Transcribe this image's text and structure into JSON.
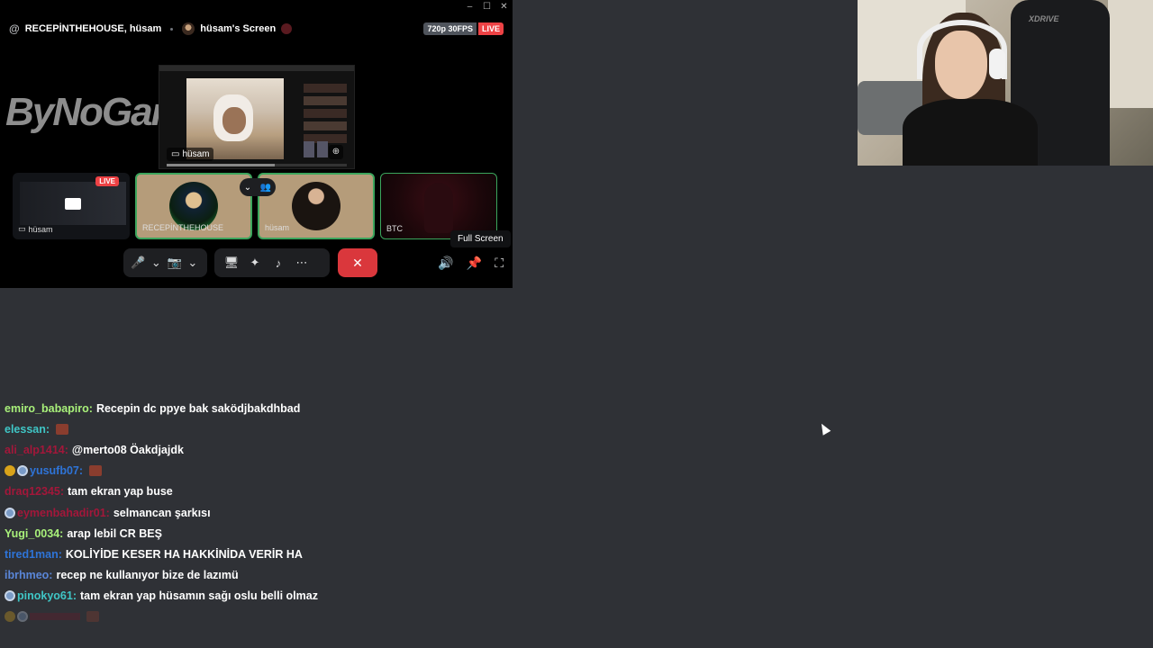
{
  "call": {
    "channel": "RECEPİNTHEHOUSE, hüsam",
    "screen_title": "hüsam's Screen",
    "quality": "720p 30FPS",
    "live_label": "LIVE",
    "brand": "ByNoGame",
    "stage_label": "hüsam",
    "tiles": [
      {
        "label": "hüsam",
        "live": "LIVE"
      },
      {
        "label": "RECEPİNTHEHOUSE"
      },
      {
        "label": "hüsam"
      },
      {
        "label": "BTC"
      }
    ],
    "tooltip": "Full Screen",
    "icons": {
      "mic": "🎤",
      "chevron": "⌄",
      "camera_off": "📷",
      "share": "🖥",
      "activity": "✦",
      "soundboard": "♪",
      "more": "⋯",
      "end": "✕",
      "volume": "🔊",
      "pin": "📌",
      "fullscreen": "⛶",
      "minimize": "–",
      "maximize": "☐",
      "close": "✕",
      "at": "@"
    }
  },
  "webcam": {
    "chair_brand": "XDRIVE"
  },
  "chat": {
    "messages": [
      {
        "user": "emiro_babapiro:",
        "color": "#a8f07a",
        "text": "Recepin dc ppye bak saködjbakdhbad"
      },
      {
        "user": "elessan:",
        "color": "#3fc6c6",
        "text": "",
        "emote": true
      },
      {
        "user": "ali_alp1414:",
        "color": "#a3173a",
        "text": "@merto08 Öakdjajdk"
      },
      {
        "user": "yusufb07:",
        "color": "#2e74d8",
        "text": "",
        "emote": true,
        "badges": [
          "gold",
          "blue"
        ]
      },
      {
        "user": "draq12345:",
        "color": "#a3173a",
        "text": "tam ekran yap buse"
      },
      {
        "user": "eymenbahadir01:",
        "color": "#a3173a",
        "text": "selmancan şarkısı",
        "badges": [
          "blue"
        ]
      },
      {
        "user": "Yugi_0034:",
        "color": "#a8f07a",
        "text": "arap lebil CR BEŞ"
      },
      {
        "user": "tired1man:",
        "color": "#2e74d8",
        "text": "KOLİYİDE KESER HA HAKKİNİDA VERİR HA"
      },
      {
        "user": "ibrhmeo:",
        "color": "#5a86d8",
        "text": "recep ne kullanıyor bize de lazımü"
      },
      {
        "user": "pinokyo61:",
        "color": "#3fc6c6",
        "text": "tam ekran yap hüsamın sağı oslu belli olmaz",
        "badges": [
          "blue"
        ]
      }
    ]
  }
}
